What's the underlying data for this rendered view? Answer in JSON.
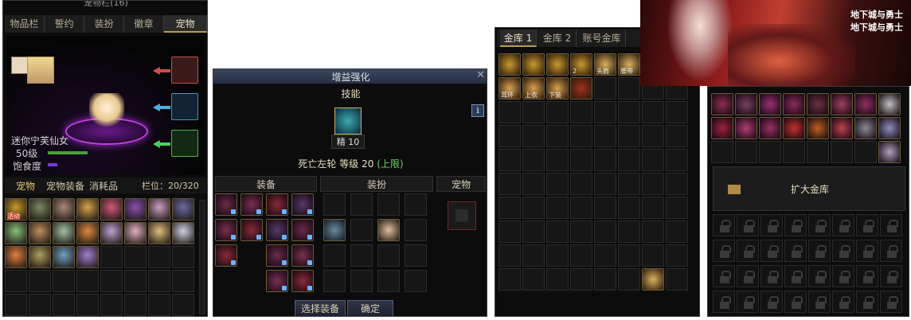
{
  "pet_window": {
    "title": "宠物栏(16)",
    "tabs": [
      "物品栏",
      "誓约",
      "装扮",
      "徽章",
      "宠物"
    ],
    "info": "i",
    "pet_name": "迷你宁芙仙女",
    "level": "50级",
    "satiety_label": "饱食度",
    "sub_tabs": [
      "宠物",
      "宠物装备",
      "消耗品"
    ],
    "slots_label": "栏位：20/320",
    "grid_items": [
      "#c99a2b",
      "#7a8a66",
      "#a98a7a",
      "#d8a24a",
      "#d05a7a",
      "#8a4fb0",
      "#c8a0c0",
      "#6a6aa0",
      "#8ac07a",
      "#c09060",
      "#a0c0a0",
      "#e08a40",
      "#c0a0d0",
      "#e0b0c0",
      "#e0c080",
      "#d0d0e0",
      "#e08040",
      "#b0a060",
      "#70a0c0",
      "#a080d0"
    ],
    "first_item_badge": "活动"
  },
  "enhance_window": {
    "title": "增益强化",
    "skills_header": "技能",
    "skill_badge": "精 10",
    "skill_name": "死亡左轮",
    "level_text": "等级 20",
    "limit_text": "(上限)",
    "sections": [
      "装备",
      "装扮",
      "宠物"
    ],
    "info": "i",
    "buttons": {
      "select": "选择装备",
      "confirm": "确定"
    }
  },
  "vault_window": {
    "tabs": [
      "金库 1",
      "金库 2",
      "账号金库"
    ],
    "items": [
      {
        "color": "#c89a30",
        "label": ""
      },
      {
        "color": "#c89a30",
        "label": ""
      },
      {
        "color": "#c89a30",
        "label": ""
      },
      {
        "color": "#c89a30",
        "label": "2"
      },
      {
        "color": "#d8b060",
        "label": "头肩"
      },
      {
        "color": "#d8b060",
        "label": "腰带"
      }
    ],
    "items_row2": [
      {
        "color": "#d8a050",
        "label": "耳环"
      },
      {
        "color": "#d8a050",
        "label": "上衣"
      },
      {
        "color": "#d8a050",
        "label": "下装"
      },
      {
        "color": "#a03020",
        "label": ""
      }
    ]
  },
  "account_vault": {
    "expand_label": "扩大金库",
    "items": [
      "#8a3050",
      "#7a4060",
      "#9a3070",
      "#8a2a5a",
      "#6a3040",
      "#a04060",
      "#903060",
      "#c0c0c0",
      "#a02040",
      "#b04070",
      "#9a3060",
      "#c03030",
      "#c06020",
      "#c04050",
      "#8a8a9a",
      "#9090c0",
      "#b0a0c0"
    ]
  },
  "banner": {
    "logo_lines": [
      "地下城与勇士",
      "地下城与勇士"
    ]
  },
  "colors": {
    "gold": "#e4c27a",
    "green": "#6ed36e",
    "purple_bar": "#7a3ad0",
    "arrow_red": "#d84a4a",
    "arrow_blue": "#4ab4e0",
    "arrow_green": "#4ad060"
  }
}
